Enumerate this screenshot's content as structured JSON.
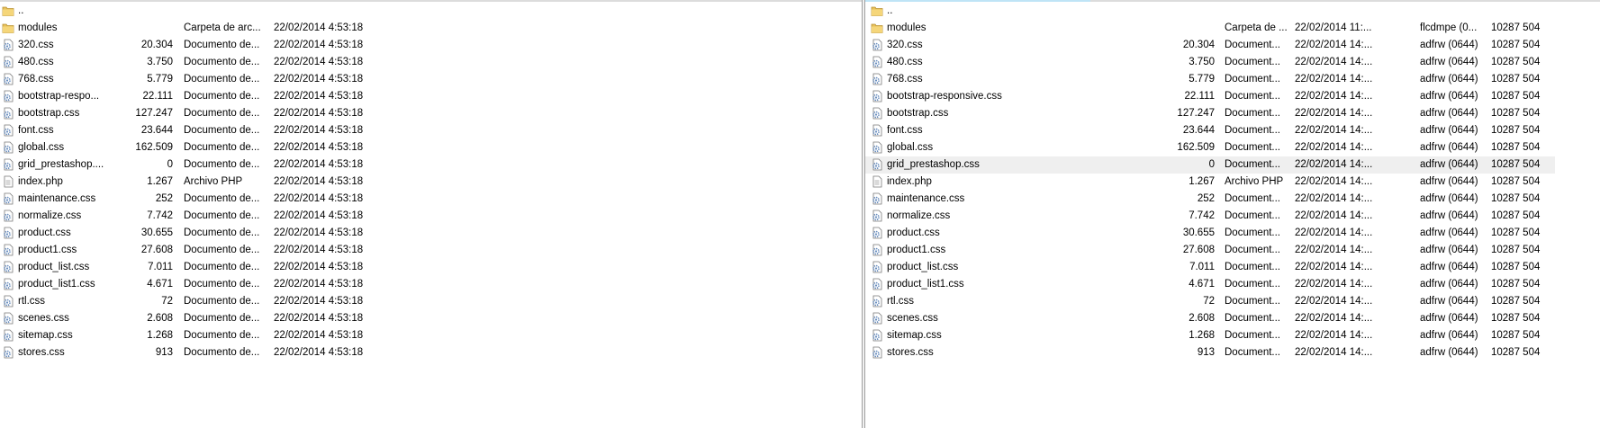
{
  "left_pane": {
    "rows": [
      {
        "name": "..",
        "size": "",
        "type": "",
        "date": "",
        "icon": "folder-icon"
      },
      {
        "name": "modules",
        "size": "",
        "type": "Carpeta de arc...",
        "date": "22/02/2014 4:53:18",
        "icon": "folder-icon"
      },
      {
        "name": "320.css",
        "size": "20.304",
        "type": "Documento de...",
        "date": "22/02/2014 4:53:18",
        "icon": "css-file-icon"
      },
      {
        "name": "480.css",
        "size": "3.750",
        "type": "Documento de...",
        "date": "22/02/2014 4:53:18",
        "icon": "css-file-icon"
      },
      {
        "name": "768.css",
        "size": "5.779",
        "type": "Documento de...",
        "date": "22/02/2014 4:53:18",
        "icon": "css-file-icon"
      },
      {
        "name": "bootstrap-respo...",
        "size": "22.111",
        "type": "Documento de...",
        "date": "22/02/2014 4:53:18",
        "icon": "css-file-icon"
      },
      {
        "name": "bootstrap.css",
        "size": "127.247",
        "type": "Documento de...",
        "date": "22/02/2014 4:53:18",
        "icon": "css-file-icon"
      },
      {
        "name": "font.css",
        "size": "23.644",
        "type": "Documento de...",
        "date": "22/02/2014 4:53:18",
        "icon": "css-file-icon"
      },
      {
        "name": "global.css",
        "size": "162.509",
        "type": "Documento de...",
        "date": "22/02/2014 4:53:18",
        "icon": "css-file-icon"
      },
      {
        "name": "grid_prestashop....",
        "size": "0",
        "type": "Documento de...",
        "date": "22/02/2014 4:53:18",
        "icon": "css-file-icon"
      },
      {
        "name": "index.php",
        "size": "1.267",
        "type": "Archivo PHP",
        "date": "22/02/2014 4:53:18",
        "icon": "php-file-icon"
      },
      {
        "name": "maintenance.css",
        "size": "252",
        "type": "Documento de...",
        "date": "22/02/2014 4:53:18",
        "icon": "css-file-icon"
      },
      {
        "name": "normalize.css",
        "size": "7.742",
        "type": "Documento de...",
        "date": "22/02/2014 4:53:18",
        "icon": "css-file-icon"
      },
      {
        "name": "product.css",
        "size": "30.655",
        "type": "Documento de...",
        "date": "22/02/2014 4:53:18",
        "icon": "css-file-icon"
      },
      {
        "name": "product1.css",
        "size": "27.608",
        "type": "Documento de...",
        "date": "22/02/2014 4:53:18",
        "icon": "css-file-icon"
      },
      {
        "name": "product_list.css",
        "size": "7.011",
        "type": "Documento de...",
        "date": "22/02/2014 4:53:18",
        "icon": "css-file-icon"
      },
      {
        "name": "product_list1.css",
        "size": "4.671",
        "type": "Documento de...",
        "date": "22/02/2014 4:53:18",
        "icon": "css-file-icon"
      },
      {
        "name": "rtl.css",
        "size": "72",
        "type": "Documento de...",
        "date": "22/02/2014 4:53:18",
        "icon": "css-file-icon"
      },
      {
        "name": "scenes.css",
        "size": "2.608",
        "type": "Documento de...",
        "date": "22/02/2014 4:53:18",
        "icon": "css-file-icon"
      },
      {
        "name": "sitemap.css",
        "size": "1.268",
        "type": "Documento de...",
        "date": "22/02/2014 4:53:18",
        "icon": "css-file-icon"
      },
      {
        "name": "stores.css",
        "size": "913",
        "type": "Documento de...",
        "date": "22/02/2014 4:53:18",
        "icon": "css-file-icon"
      }
    ]
  },
  "right_pane": {
    "selected_index": 9,
    "rows": [
      {
        "name": "..",
        "size": "",
        "type": "",
        "date": "",
        "perm": "",
        "owner": "",
        "icon": "folder-icon"
      },
      {
        "name": "modules",
        "size": "",
        "type": "Carpeta de ...",
        "date": "22/02/2014 11:...",
        "perm": "flcdmpe (0...",
        "owner": "10287 504",
        "icon": "folder-icon"
      },
      {
        "name": "320.css",
        "size": "20.304",
        "type": "Document...",
        "date": "22/02/2014 14:...",
        "perm": "adfrw (0644)",
        "owner": "10287 504",
        "icon": "css-file-icon"
      },
      {
        "name": "480.css",
        "size": "3.750",
        "type": "Document...",
        "date": "22/02/2014 14:...",
        "perm": "adfrw (0644)",
        "owner": "10287 504",
        "icon": "css-file-icon"
      },
      {
        "name": "768.css",
        "size": "5.779",
        "type": "Document...",
        "date": "22/02/2014 14:...",
        "perm": "adfrw (0644)",
        "owner": "10287 504",
        "icon": "css-file-icon"
      },
      {
        "name": "bootstrap-responsive.css",
        "size": "22.111",
        "type": "Document...",
        "date": "22/02/2014 14:...",
        "perm": "adfrw (0644)",
        "owner": "10287 504",
        "icon": "css-file-icon"
      },
      {
        "name": "bootstrap.css",
        "size": "127.247",
        "type": "Document...",
        "date": "22/02/2014 14:...",
        "perm": "adfrw (0644)",
        "owner": "10287 504",
        "icon": "css-file-icon"
      },
      {
        "name": "font.css",
        "size": "23.644",
        "type": "Document...",
        "date": "22/02/2014 14:...",
        "perm": "adfrw (0644)",
        "owner": "10287 504",
        "icon": "css-file-icon"
      },
      {
        "name": "global.css",
        "size": "162.509",
        "type": "Document...",
        "date": "22/02/2014 14:...",
        "perm": "adfrw (0644)",
        "owner": "10287 504",
        "icon": "css-file-icon"
      },
      {
        "name": "grid_prestashop.css",
        "size": "0",
        "type": "Document...",
        "date": "22/02/2014 14:...",
        "perm": "adfrw (0644)",
        "owner": "10287 504",
        "icon": "css-file-icon"
      },
      {
        "name": "index.php",
        "size": "1.267",
        "type": "Archivo PHP",
        "date": "22/02/2014 14:...",
        "perm": "adfrw (0644)",
        "owner": "10287 504",
        "icon": "php-file-icon"
      },
      {
        "name": "maintenance.css",
        "size": "252",
        "type": "Document...",
        "date": "22/02/2014 14:...",
        "perm": "adfrw (0644)",
        "owner": "10287 504",
        "icon": "css-file-icon"
      },
      {
        "name": "normalize.css",
        "size": "7.742",
        "type": "Document...",
        "date": "22/02/2014 14:...",
        "perm": "adfrw (0644)",
        "owner": "10287 504",
        "icon": "css-file-icon"
      },
      {
        "name": "product.css",
        "size": "30.655",
        "type": "Document...",
        "date": "22/02/2014 14:...",
        "perm": "adfrw (0644)",
        "owner": "10287 504",
        "icon": "css-file-icon"
      },
      {
        "name": "product1.css",
        "size": "27.608",
        "type": "Document...",
        "date": "22/02/2014 14:...",
        "perm": "adfrw (0644)",
        "owner": "10287 504",
        "icon": "css-file-icon"
      },
      {
        "name": "product_list.css",
        "size": "7.011",
        "type": "Document...",
        "date": "22/02/2014 14:...",
        "perm": "adfrw (0644)",
        "owner": "10287 504",
        "icon": "css-file-icon"
      },
      {
        "name": "product_list1.css",
        "size": "4.671",
        "type": "Document...",
        "date": "22/02/2014 14:...",
        "perm": "adfrw (0644)",
        "owner": "10287 504",
        "icon": "css-file-icon"
      },
      {
        "name": "rtl.css",
        "size": "72",
        "type": "Document...",
        "date": "22/02/2014 14:...",
        "perm": "adfrw (0644)",
        "owner": "10287 504",
        "icon": "css-file-icon"
      },
      {
        "name": "scenes.css",
        "size": "2.608",
        "type": "Document...",
        "date": "22/02/2014 14:...",
        "perm": "adfrw (0644)",
        "owner": "10287 504",
        "icon": "css-file-icon"
      },
      {
        "name": "sitemap.css",
        "size": "1.268",
        "type": "Document...",
        "date": "22/02/2014 14:...",
        "perm": "adfrw (0644)",
        "owner": "10287 504",
        "icon": "css-file-icon"
      },
      {
        "name": "stores.css",
        "size": "913",
        "type": "Document...",
        "date": "22/02/2014 14:...",
        "perm": "adfrw (0644)",
        "owner": "10287 504",
        "icon": "css-file-icon"
      }
    ]
  },
  "colors": {
    "selected_row": "#efefef",
    "folder": "#e8c15a",
    "css_gear": "#6b8fbf",
    "divider": "#a0a0a0"
  }
}
